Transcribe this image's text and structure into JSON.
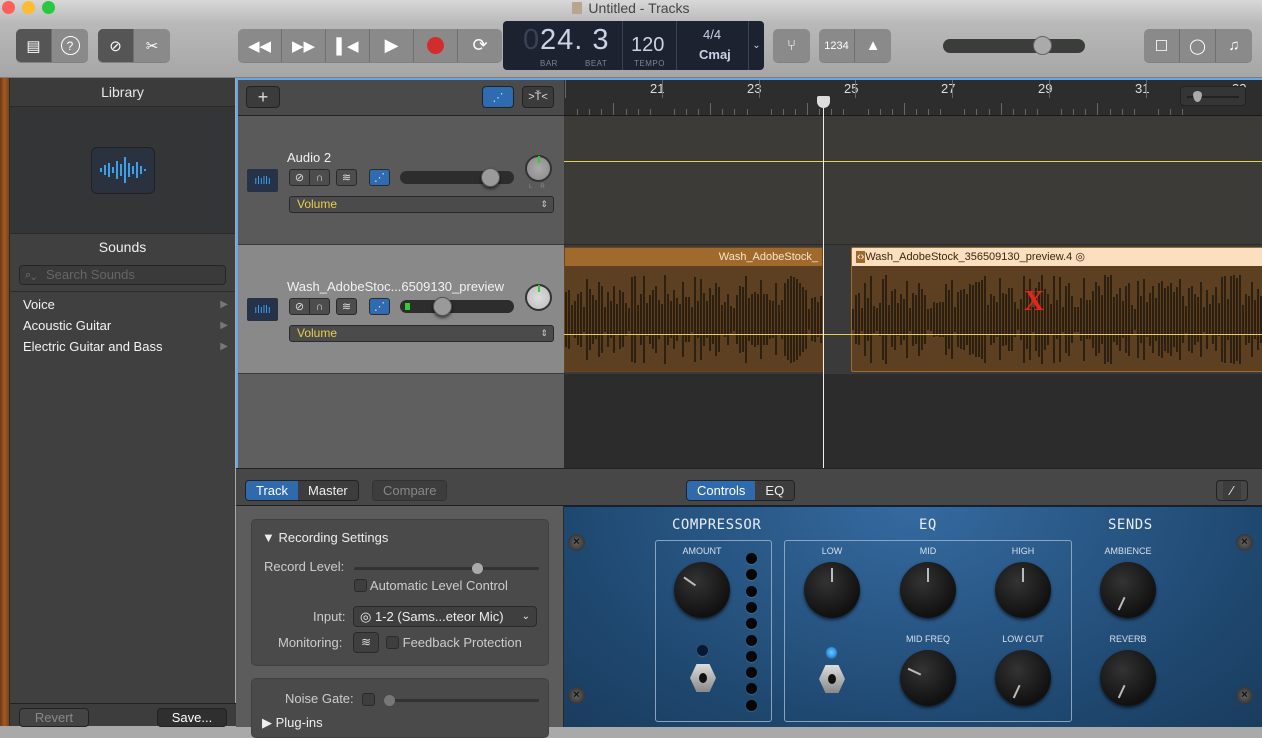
{
  "window": {
    "title": "Untitled - Tracks"
  },
  "toolbar": {
    "library_btn": "library-icon",
    "help_btn": "help-icon",
    "smart_controls_btn": "smart-controls-icon",
    "editors_btn": "scissors-icon",
    "transport": [
      "rewind",
      "fast-forward",
      "go-to-beginning",
      "play",
      "record",
      "cycle"
    ],
    "lcd": {
      "bar_prefix": "0",
      "position": "24. 3",
      "bar_label": "BAR",
      "beat_label": "BEAT",
      "tempo": "120",
      "tempo_label": "TEMPO",
      "time_signature": "4/4",
      "key": "Cmaj"
    },
    "count_in": "1234",
    "master_volume": 0.73,
    "right_buttons": [
      "note-pad-icon",
      "loop-browser-icon",
      "media-browser-icon"
    ]
  },
  "library": {
    "header": "Library",
    "sounds_header": "Sounds",
    "search_placeholder": "Search Sounds",
    "items": [
      {
        "label": "Voice"
      },
      {
        "label": "Acoustic Guitar"
      },
      {
        "label": "Electric Guitar and Bass"
      }
    ],
    "revert_label": "Revert",
    "save_label": "Save..."
  },
  "tracks": {
    "add_label": "+",
    "list": [
      {
        "name": "Audio 2",
        "automation": "Volume",
        "volume": 0.85,
        "selected": false
      },
      {
        "name": "Wash_AdobeStoc...6509130_preview",
        "automation": "Volume",
        "volume": 0.35,
        "selected": true
      }
    ],
    "ruler": {
      "bars": [
        "21",
        "23",
        "25",
        "27",
        "29",
        "31",
        "33"
      ]
    },
    "regions": [
      {
        "label": "Wash_AdobeStock_",
        "track": 1
      },
      {
        "label": "Wash_AdobeStock_356509130_preview.4",
        "track": 1,
        "selected": true
      }
    ],
    "marker": "X",
    "playhead_bar": "24.3"
  },
  "bottom": {
    "tabs": [
      {
        "label": "Track",
        "active": true
      },
      {
        "label": "Master",
        "active": false
      }
    ],
    "compare_label": "Compare",
    "view_tabs": [
      {
        "label": "Controls",
        "active": true
      },
      {
        "label": "EQ",
        "active": false
      }
    ],
    "recording": {
      "title": "Recording Settings",
      "record_level_label": "Record Level:",
      "record_level": 0.68,
      "alc_label": "Automatic Level Control",
      "input_label": "Input:",
      "input_value": "1-2  (Sams...eteor Mic)",
      "monitoring_label": "Monitoring:",
      "feedback_label": "Feedback Protection"
    },
    "noise_gate_label": "Noise Gate:",
    "plugins_label": "Plug-ins"
  },
  "plugin": {
    "compressor": {
      "title": "COMPRESSOR",
      "amount_label": "AMOUNT"
    },
    "eq": {
      "title": "EQ",
      "knobs": [
        "LOW",
        "MID",
        "HIGH",
        "MID FREQ",
        "LOW CUT"
      ]
    },
    "sends": {
      "title": "SENDS",
      "knobs": [
        "AMBIENCE",
        "REVERB"
      ]
    }
  }
}
